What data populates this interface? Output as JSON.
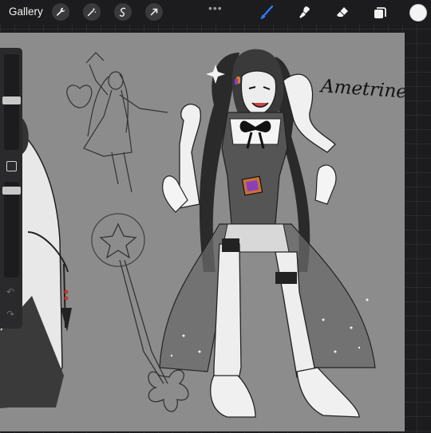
{
  "toolbar": {
    "gallery_label": "Gallery",
    "more_label": "•••",
    "tools": [
      "wrench-icon",
      "magic-wand-icon",
      "selection-icon",
      "transform-icon"
    ],
    "paint_tools": [
      "brush-icon",
      "smudge-icon",
      "eraser-icon",
      "layers-icon"
    ],
    "active_tool": "brush-icon",
    "current_color": "#f4f4f4",
    "accent_color": "#2f7bff"
  },
  "canvas": {
    "handwritten_name": "Ametrine"
  },
  "sidebar": {
    "undo_label": "↶",
    "redo_label": "↷"
  }
}
